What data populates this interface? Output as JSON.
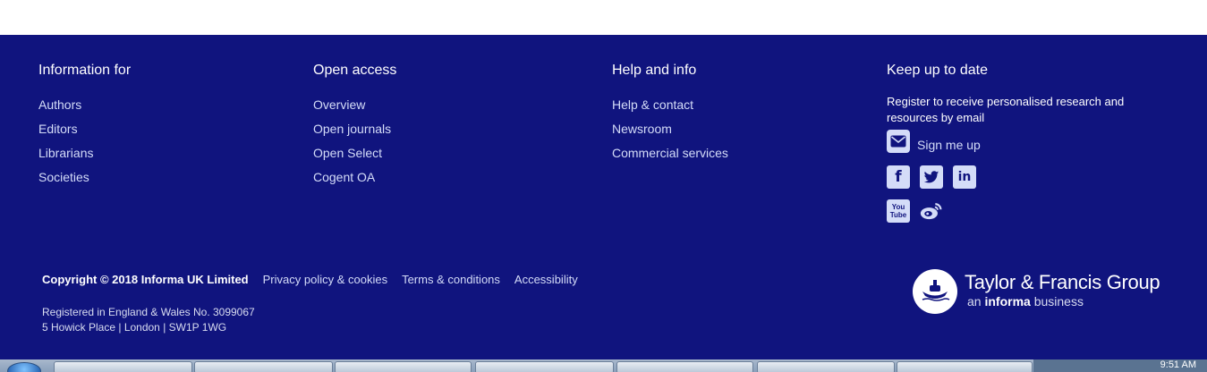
{
  "footer": {
    "col1": {
      "title": "Information for",
      "links": [
        "Authors",
        "Editors",
        "Librarians",
        "Societies"
      ]
    },
    "col2": {
      "title": "Open access",
      "links": [
        "Overview",
        "Open journals",
        "Open Select",
        "Cogent OA"
      ]
    },
    "col3": {
      "title": "Help and info",
      "links": [
        "Help & contact",
        "Newsroom",
        "Commercial services"
      ]
    },
    "col4": {
      "title": "Keep up to date",
      "register_text": "Register to receive personalised research and resources by email",
      "signup_label": "Sign me up",
      "social_icons": [
        "facebook-icon",
        "twitter-icon",
        "linkedin-icon",
        "youtube-icon",
        "weibo-icon"
      ]
    },
    "copyright": "Copyright © 2018 Informa UK Limited",
    "legal_links": [
      "Privacy policy & cookies",
      "Terms & conditions",
      "Accessibility"
    ],
    "address_line1": "Registered in England & Wales No. 3099067",
    "address_line2": "5 Howick Place | London | SW1P 1WG",
    "brand_name": "Taylor & Francis Group",
    "brand_sub_prefix": "an",
    "brand_sub_bold": "informa",
    "brand_sub_suffix": "business"
  },
  "taskbar": {
    "clock": "9:51 AM"
  },
  "colors": {
    "footer_bg": "#10147e",
    "link": "#d4dcf8",
    "text": "#ffffff"
  }
}
